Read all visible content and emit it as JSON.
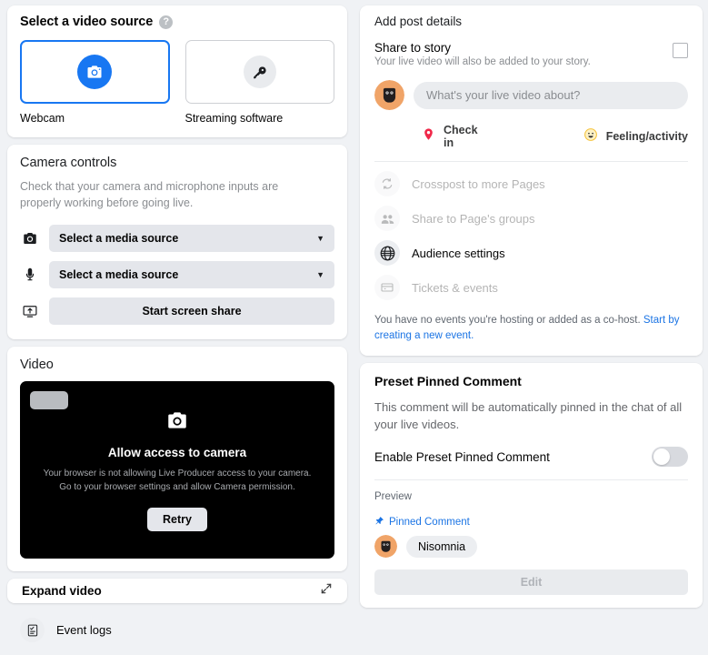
{
  "video_source": {
    "title": "Select a video source",
    "help_icon": "help-circle-icon",
    "options": [
      {
        "label": "Webcam",
        "icon": "camera-icon",
        "selected": true
      },
      {
        "label": "Streaming software",
        "icon": "key-icon",
        "selected": false
      }
    ]
  },
  "camera_controls": {
    "title": "Camera controls",
    "description": "Check that your camera and microphone inputs are properly working before going live.",
    "camera_select": {
      "icon": "camera-icon",
      "value": "Select a media source",
      "caret": "▼"
    },
    "mic_select": {
      "icon": "microphone-icon",
      "value": "Select a media source",
      "caret": "▼"
    },
    "screen_share": {
      "icon": "screen-share-icon",
      "label": "Start screen share"
    }
  },
  "video": {
    "title": "Video",
    "heading": "Allow access to camera",
    "message": "Your browser is not allowing Live Producer access to your camera. Go to your browser settings and allow Camera permission.",
    "retry_label": "Retry",
    "camera_icon": "camera-icon"
  },
  "expand": {
    "label": "Expand video",
    "icon": "expand-arrows-icon"
  },
  "event_logs": {
    "label": "Event logs",
    "icon": "clipboard-check-icon"
  },
  "post_details": {
    "title": "Add post details",
    "share_to_story": {
      "title": "Share to story",
      "subtitle": "Your live video will also be added to your story.",
      "checked": false
    },
    "composer": {
      "placeholder": "What's your live video about?",
      "value": "",
      "avatar": "user-avatar"
    },
    "quick_actions": [
      {
        "label": "Check in",
        "icon": "location-pin-icon",
        "color": "#f02849"
      },
      {
        "label": "Feeling/activity",
        "icon": "smiley-face-icon",
        "color": "#f5c33b"
      }
    ],
    "options": [
      {
        "label": "Crosspost to more Pages",
        "icon": "crosspost-icon",
        "disabled": true
      },
      {
        "label": "Share to Page's groups",
        "icon": "groups-icon",
        "disabled": true
      },
      {
        "label": "Audience settings",
        "icon": "globe-icon",
        "disabled": false
      },
      {
        "label": "Tickets & events",
        "icon": "ticket-icon",
        "disabled": true
      }
    ],
    "events_note": "You have no events you're hosting or added as a co-host. ",
    "events_link": "Start by creating a new event."
  },
  "pinned_comment": {
    "title": "Preset Pinned Comment",
    "description": "This comment will be automatically pinned in the chat of all your live videos.",
    "toggle_label": "Enable Preset Pinned Comment",
    "toggle_on": false,
    "preview_label": "Preview",
    "pinned_badge": "Pinned Comment",
    "pin_icon": "pin-icon",
    "comment_author": "Nisomnia",
    "edit_label": "Edit"
  },
  "colors": {
    "page_bg": "#f0f2f5",
    "card_bg": "#ffffff",
    "accent_blue": "#1877f2",
    "link_blue": "#1b74e4",
    "control_gray": "#e4e6eb",
    "muted_text": "#8a8d91",
    "avatar_orange": "#f0a468",
    "pin_red": "#f02849",
    "smiley_yellow": "#f5c33b"
  }
}
